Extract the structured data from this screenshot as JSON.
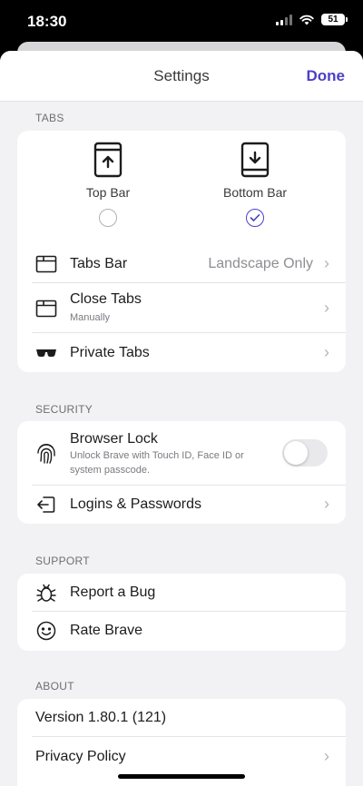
{
  "status_bar": {
    "time": "18:30",
    "battery": "51"
  },
  "nav": {
    "title": "Settings",
    "done": "Done"
  },
  "tabs": {
    "header": "TABS",
    "layout_options": [
      {
        "label": "Top Bar",
        "selected": false
      },
      {
        "label": "Bottom Bar",
        "selected": true
      }
    ],
    "rows": [
      {
        "label": "Tabs Bar",
        "value": "Landscape Only"
      },
      {
        "label": "Close Tabs",
        "subtitle": "Manually"
      },
      {
        "label": "Private Tabs"
      }
    ]
  },
  "security": {
    "header": "SECURITY",
    "browser_lock": {
      "label": "Browser Lock",
      "subtitle_line1": "Unlock Brave with Touch ID, Face ID or",
      "subtitle_line2": "system passcode.",
      "enabled": false
    },
    "logins": {
      "label": "Logins & Passwords"
    }
  },
  "support": {
    "header": "SUPPORT",
    "rows": [
      {
        "label": "Report a Bug"
      },
      {
        "label": "Rate Brave"
      }
    ]
  },
  "about": {
    "header": "ABOUT",
    "rows": [
      {
        "label": "Version 1.80.1 (121)"
      },
      {
        "label": "Privacy Policy"
      }
    ]
  },
  "colors": {
    "accent": "#4b40c9",
    "background": "#f2f2f4",
    "card": "#ffffff"
  }
}
